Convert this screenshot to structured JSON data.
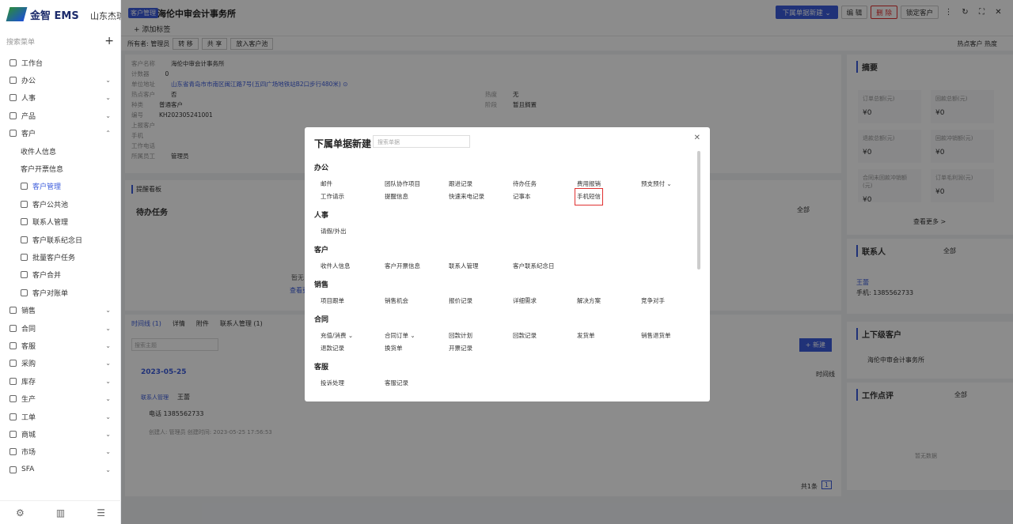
{
  "sidebar": {
    "logo_text": "金智 EMS",
    "search_placeholder": "搜索菜单",
    "items": [
      {
        "label": "工作台",
        "icon": "dashboard-icon",
        "arrow": ""
      },
      {
        "label": "办公",
        "icon": "office-icon",
        "arrow": "⌄"
      },
      {
        "label": "人事",
        "icon": "people-icon",
        "arrow": "⌄"
      },
      {
        "label": "产品",
        "icon": "product-icon",
        "arrow": "⌄"
      },
      {
        "label": "客户",
        "icon": "customer-icon",
        "arrow": "⌃"
      },
      {
        "label": "收件人信息",
        "icon": "",
        "arrow": "",
        "sub": true
      },
      {
        "label": "客户开票信息",
        "icon": "",
        "arrow": "",
        "sub": true
      },
      {
        "label": "客户管理",
        "icon": "customer-mgmt-icon",
        "arrow": "",
        "sub": true,
        "active": true
      },
      {
        "label": "客户公共池",
        "icon": "pool-icon",
        "arrow": "",
        "sub": true
      },
      {
        "label": "联系人管理",
        "icon": "contact-icon",
        "arrow": "",
        "sub": true
      },
      {
        "label": "客户联系纪念日",
        "icon": "date-icon",
        "arrow": "",
        "sub": true
      },
      {
        "label": "批量客户任务",
        "icon": "task-icon",
        "arrow": "",
        "sub": true
      },
      {
        "label": "客户合并",
        "icon": "merge-icon",
        "arrow": "",
        "sub": true
      },
      {
        "label": "客户对账单",
        "icon": "statement-icon",
        "arrow": "",
        "sub": true
      },
      {
        "label": "销售",
        "icon": "sales-icon",
        "arrow": "⌄"
      },
      {
        "label": "合同",
        "icon": "contract-icon",
        "arrow": "⌄"
      },
      {
        "label": "客服",
        "icon": "service-icon",
        "arrow": "⌄"
      },
      {
        "label": "采购",
        "icon": "purchase-icon",
        "arrow": "⌄"
      },
      {
        "label": "库存",
        "icon": "stock-icon",
        "arrow": "⌄"
      },
      {
        "label": "生产",
        "icon": "production-icon",
        "arrow": "⌄"
      },
      {
        "label": "工单",
        "icon": "workorder-icon",
        "arrow": "⌄"
      },
      {
        "label": "商城",
        "icon": "mall-icon",
        "arrow": "⌄"
      },
      {
        "label": "市场",
        "icon": "market-icon",
        "arrow": "⌄"
      },
      {
        "label": "SFA",
        "icon": "sfa-icon",
        "arrow": "⌄"
      }
    ]
  },
  "top": {
    "left_fragment": "山东杰瑞",
    "badge": "客户管理",
    "title": "海伦中审会计事务所",
    "add_tag": "+ 添加标签",
    "new_btn": "下属单据新建 ⌄",
    "edit_btn": "编 辑",
    "delete_btn": "删 除",
    "lock_btn": "锁定客户"
  },
  "subbar": {
    "owner": "所有者: 管理员",
    "transfer": "转 移",
    "share": "共 享",
    "to_pool": "放入客户池",
    "right": "热点客户  热度"
  },
  "info": {
    "rows": [
      {
        "k": "客户名称",
        "v": "海伦中审会计事务所"
      },
      {
        "k": "计数器",
        "v": "0"
      },
      {
        "k": "单位地址",
        "v": "山东省青岛市市南区闽江路7号(五四广场地铁站B2口步行480米) ⊙"
      },
      {
        "k": "热点客户",
        "v": "否"
      },
      {
        "k": "种类",
        "v": "普通客户"
      },
      {
        "k": "编号",
        "v": "KH202305241001"
      },
      {
        "k": "上报客户",
        "v": ""
      },
      {
        "k": "手机",
        "v": ""
      },
      {
        "k": "工作电话",
        "v": ""
      },
      {
        "k": "所属员工",
        "v": "管理员"
      }
    ],
    "heat": {
      "k": "热度",
      "v": "无"
    },
    "stage": {
      "k": "阶段",
      "v": "暂且搁置"
    }
  },
  "remind": {
    "title": "提醒看板",
    "todo": "待办任务",
    "filter": "全部",
    "empty": "暂无",
    "more": "查看更"
  },
  "timeline": {
    "tabs": [
      "时间线 (1)",
      "详情",
      "附件",
      "联系人管理 (1)"
    ],
    "search_placeholder": "搜索主题",
    "new_btn": "+ 新建",
    "date": "2023-05-25",
    "view": "时间线",
    "entry_tag": "联系人管理",
    "entry_name": "王蕾",
    "phone": "电话 1385562733",
    "creator": "创建人: 管理员   创建时间: 2023-05-25 17:56:53",
    "total": "共1条",
    "page": "1"
  },
  "right": {
    "summary_title": "摘要",
    "minis": [
      {
        "k": "订单总额(元)",
        "v": "¥0"
      },
      {
        "k": "回款总额(元)",
        "v": "¥0"
      },
      {
        "k": "退款总额(元)",
        "v": "¥0"
      },
      {
        "k": "回款冲销额(元)",
        "v": "¥0"
      },
      {
        "k": "合同未回款冲销额(元)",
        "v": "¥0"
      },
      {
        "k": "订单毛利润(元)",
        "v": "¥0"
      }
    ],
    "more": "查看更多 >",
    "contact_title": "联系人",
    "contact_filter": "全部",
    "contact_name": "王蕾",
    "contact_phone": "手机:   1385562733",
    "parent_title": "上下级客户",
    "parent_name": "海伦中审会计事务所",
    "review_title": "工作点评",
    "review_filter": "全部",
    "review_empty": "暂无数据"
  },
  "modal": {
    "title": "下属单据新建",
    "search_placeholder": "搜索单据",
    "sections": [
      {
        "title": "办公",
        "items": [
          "邮件",
          "团队协作项目",
          "跟进记录",
          "待办任务",
          "费用报销",
          "预支预付 ⌄",
          "工作请示",
          "提醒信息",
          "快速来电记录",
          "记事本",
          "手机短信"
        ]
      },
      {
        "title": "人事",
        "items": [
          "请假/外出"
        ]
      },
      {
        "title": "客户",
        "items": [
          "收件人信息",
          "客户开票信息",
          "联系人管理",
          "客户联系纪念日"
        ]
      },
      {
        "title": "销售",
        "items": [
          "项目跟单",
          "销售机会",
          "报价记录",
          "详细需求",
          "解决方案",
          "竞争对手"
        ]
      },
      {
        "title": "合同",
        "items": [
          "充值/消费 ⌄",
          "合同订单 ⌄",
          "回款计划",
          "回款记录",
          "发货单",
          "销售退货单",
          "退款记录",
          "换货单",
          "开票记录"
        ]
      },
      {
        "title": "客服",
        "items": [
          "投诉处理",
          "客服记录"
        ]
      }
    ],
    "highlighted": "手机短信"
  },
  "colors": {
    "accent": "#3b5bdb",
    "danger": "#e03131"
  }
}
